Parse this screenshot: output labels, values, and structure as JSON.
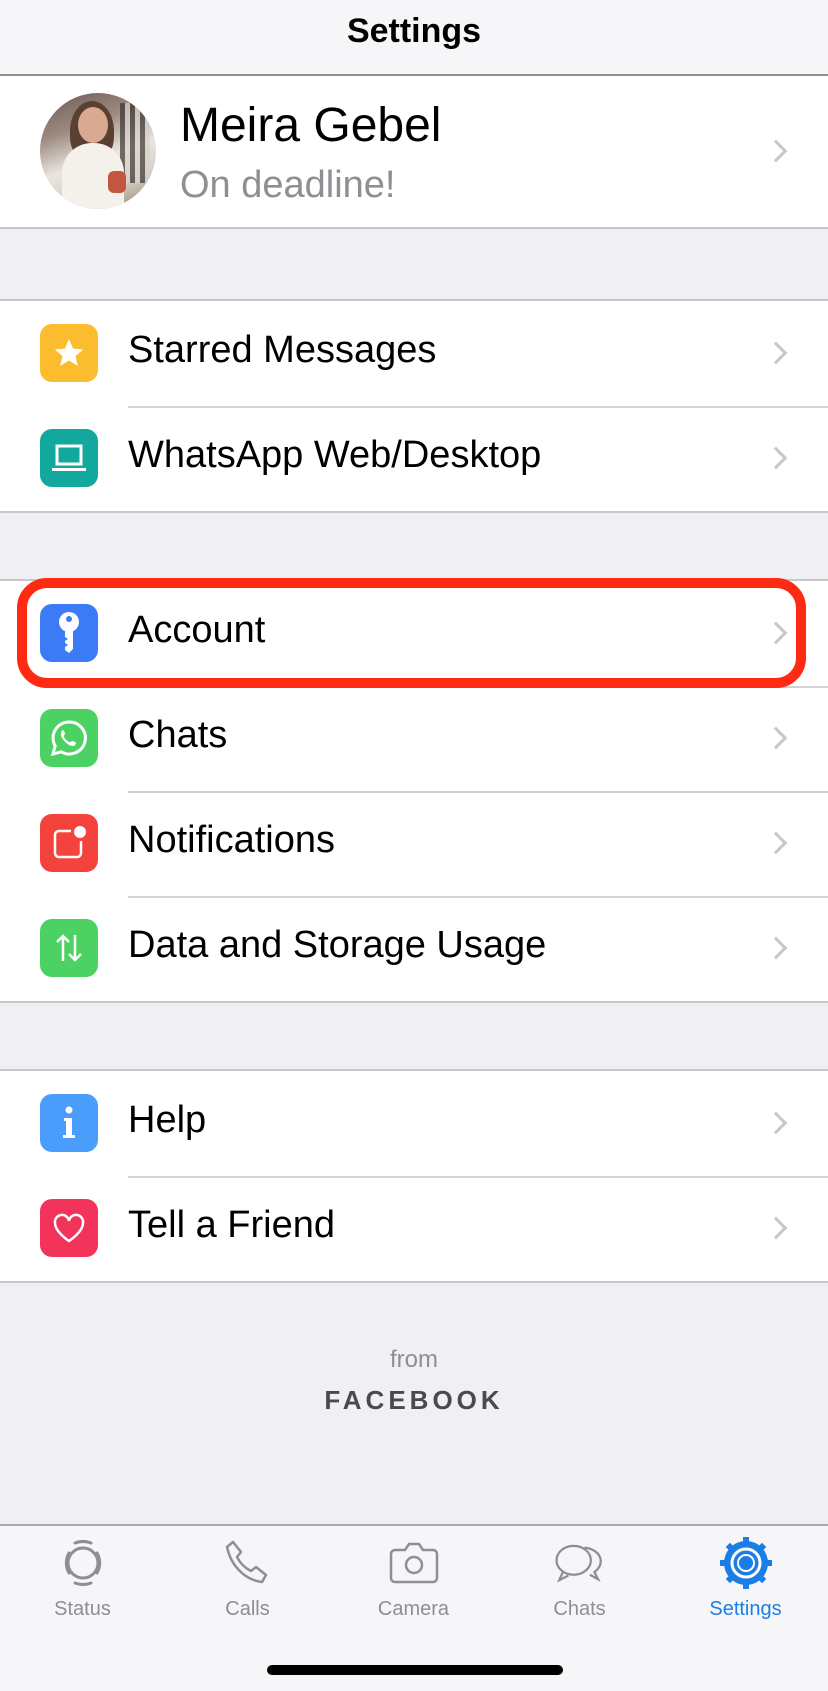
{
  "nav": {
    "title": "Settings"
  },
  "profile": {
    "name": "Meira Gebel",
    "status": "On deadline!",
    "avatar_icon": "profile-photo"
  },
  "groups": [
    {
      "items": [
        {
          "label": "Starred Messages",
          "icon": "star-icon",
          "color": "#fbbd2e"
        },
        {
          "label": "WhatsApp Web/Desktop",
          "icon": "laptop-icon",
          "color": "#13a89e"
        }
      ]
    },
    {
      "items": [
        {
          "label": "Account",
          "icon": "key-icon",
          "color": "#3b7bf5",
          "highlighted": true
        },
        {
          "label": "Chats",
          "icon": "whatsapp-icon",
          "color": "#4cd263"
        },
        {
          "label": "Notifications",
          "icon": "notification-icon",
          "color": "#f4433c"
        },
        {
          "label": "Data and Storage Usage",
          "icon": "data-arrows-icon",
          "color": "#4cd263"
        }
      ]
    },
    {
      "items": [
        {
          "label": "Help",
          "icon": "info-icon",
          "color": "#4a9dfa"
        },
        {
          "label": "Tell a Friend",
          "icon": "heart-icon",
          "color": "#f2345b"
        }
      ]
    }
  ],
  "footer": {
    "from": "from",
    "brand": "FACEBOOK"
  },
  "tabbar": {
    "active_color": "#1a7ee6",
    "inactive_color": "#8e8e93",
    "tabs": [
      {
        "label": "Status",
        "icon": "status-icon",
        "active": false
      },
      {
        "label": "Calls",
        "icon": "phone-icon",
        "active": false
      },
      {
        "label": "Camera",
        "icon": "camera-icon",
        "active": false
      },
      {
        "label": "Chats",
        "icon": "chat-bubbles-icon",
        "active": false
      },
      {
        "label": "Settings",
        "icon": "gear-icon",
        "active": true
      }
    ]
  },
  "highlight_color": "#ff2a12"
}
